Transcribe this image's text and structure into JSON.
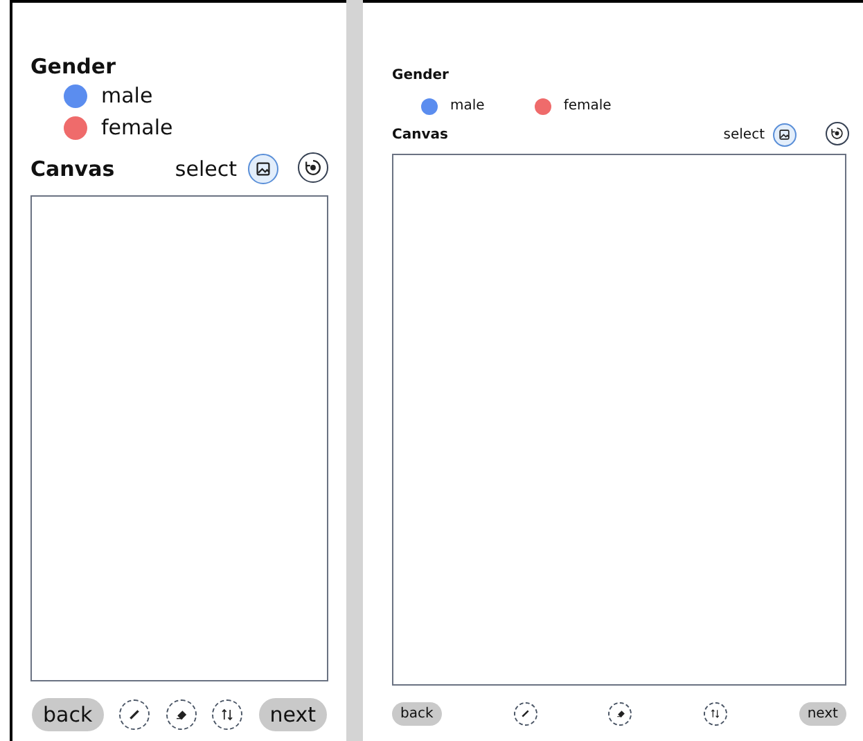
{
  "panels": [
    {
      "kind": "phone",
      "gender": {
        "label": "Gender",
        "options": [
          {
            "label": "male",
            "color": "#5b8def"
          },
          {
            "label": "female",
            "color": "#ef6b6b"
          }
        ]
      },
      "canvas": {
        "label": "Canvas",
        "select_label": "select"
      },
      "buttons": {
        "back": "back",
        "next": "next"
      }
    },
    {
      "kind": "tablet",
      "gender": {
        "label": "Gender",
        "options": [
          {
            "label": "male",
            "color": "#5b8def"
          },
          {
            "label": "female",
            "color": "#ef6b6b"
          }
        ]
      },
      "canvas": {
        "label": "Canvas",
        "select_label": "select"
      },
      "buttons": {
        "back": "back",
        "next": "next"
      }
    }
  ]
}
